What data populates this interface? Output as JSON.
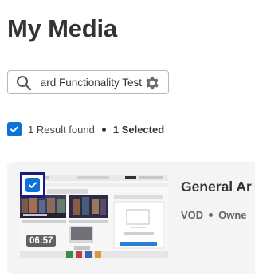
{
  "page": {
    "title": "My Media"
  },
  "search": {
    "value": "Keyboard Functionality Test"
  },
  "results": {
    "found_text": "1 Result found",
    "selected_text": "1 Selected"
  },
  "entry": {
    "title": "General Ar",
    "type": "VOD",
    "owner_label": "Owne",
    "duration": "06:57"
  },
  "colors": {
    "checkbox": "#0b72d8",
    "focus_ring": "#1b1b80",
    "card_bg": "#f4f4f4"
  }
}
